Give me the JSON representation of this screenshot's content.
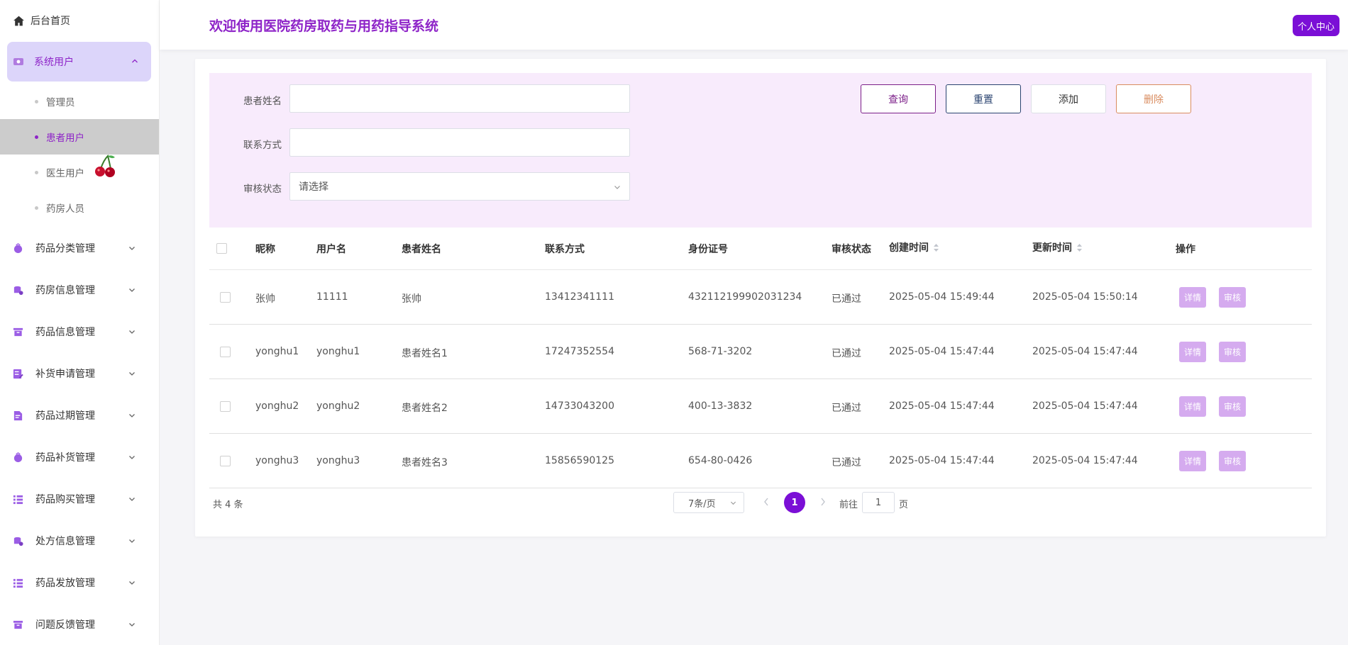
{
  "sidebar": {
    "home": "后台首页",
    "active_group": "系统用户",
    "sub_items": [
      "管理员",
      "患者用户",
      "医生用户",
      "药房人员"
    ],
    "menu": [
      "药品分类管理",
      "药房信息管理",
      "药品信息管理",
      "补货申请管理",
      "药品过期管理",
      "药品补货管理",
      "药品购买管理",
      "处方信息管理",
      "药品发放管理",
      "问题反馈管理"
    ]
  },
  "header": {
    "title": "欢迎使用医院药房取药与用药指导系统",
    "profile": "个人中心"
  },
  "filter": {
    "name_label": "患者姓名",
    "name_value": "",
    "phone_label": "联系方式",
    "phone_value": "",
    "status_label": "审核状态",
    "status_value": "请选择",
    "query": "查询",
    "reset": "重置",
    "add": "添加",
    "delete": "删除"
  },
  "table": {
    "columns": [
      "昵称",
      "用户名",
      "患者姓名",
      "联系方式",
      "身份证号",
      "审核状态",
      "创建时间",
      "更新时间",
      "操作"
    ],
    "rows": [
      [
        "张帅",
        "11111",
        "张帅",
        "13412341111",
        "432112199902031234",
        "已通过",
        "2025-05-04 15:49:44",
        "2025-05-04 15:50:14"
      ],
      [
        "yonghu1",
        "yonghu1",
        "患者姓名1",
        "17247352554",
        "568-71-3202",
        "已通过",
        "2025-05-04 15:47:44",
        "2025-05-04 15:47:44"
      ],
      [
        "yonghu2",
        "yonghu2",
        "患者姓名2",
        "14733043200",
        "400-13-3832",
        "已通过",
        "2025-05-04 15:47:44",
        "2025-05-04 15:47:44"
      ],
      [
        "yonghu3",
        "yonghu3",
        "患者姓名3",
        "15856590125",
        "654-80-0426",
        "已通过",
        "2025-05-04 15:47:44",
        "2025-05-04 15:47:44"
      ]
    ],
    "detail": "详情",
    "audit": "审核"
  },
  "pager": {
    "total": "共 4 条",
    "page_size": "7条/页",
    "current": "1",
    "goto_prefix": "前往",
    "goto_value": "1",
    "goto_suffix": "页"
  },
  "colors": {
    "accent": "#7b0fd6",
    "title": "#8e24c8",
    "filter_bg": "#f8ebfc",
    "op_button": "#d5abef"
  }
}
